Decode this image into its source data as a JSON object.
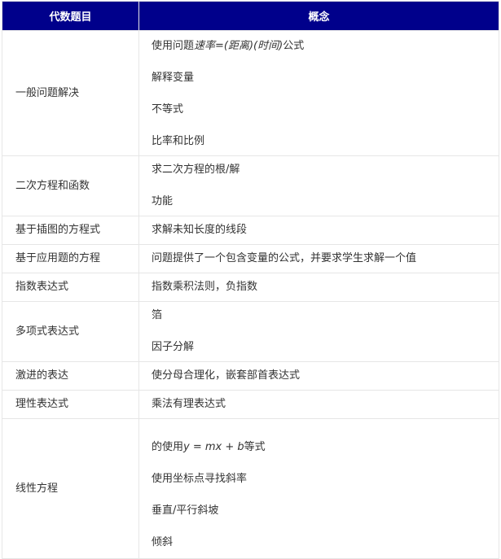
{
  "header": {
    "topic_label": "代数题目",
    "concept_label": "概念"
  },
  "rows": [
    {
      "topic": "一般问题解决",
      "concepts": [
        "使用问题",
        "速率=(距离)(时间)",
        "公式",
        "解释变量",
        "不等式",
        "比率和比例"
      ]
    },
    {
      "topic": "二次方程和函数",
      "concepts": [
        "求二次方程的根/解",
        "功能"
      ]
    },
    {
      "topic": "基于插图的方程式",
      "concepts": [
        "求解未知长度的线段"
      ]
    },
    {
      "topic": "基于应用题的方程",
      "concepts": [
        "问题提供了一个包含变量的公式，并要求学生求解一个值"
      ]
    },
    {
      "topic": "指数表达式",
      "concepts": [
        "指数乘积法则，负指数"
      ]
    },
    {
      "topic": "多项式表达式",
      "concepts": [
        "箔",
        "因子分解"
      ]
    },
    {
      "topic": "激进的表达",
      "concepts": [
        "使分母合理化，嵌套部首表达式"
      ]
    },
    {
      "topic": "理性表达式",
      "concepts": [
        "乘法有理表达式"
      ]
    },
    {
      "topic": "线性方程",
      "concepts": [
        "的使用",
        "y = mx + b",
        "等式",
        "使用坐标点寻找斜率",
        "垂直/平行斜坡",
        "倾斜"
      ]
    }
  ]
}
